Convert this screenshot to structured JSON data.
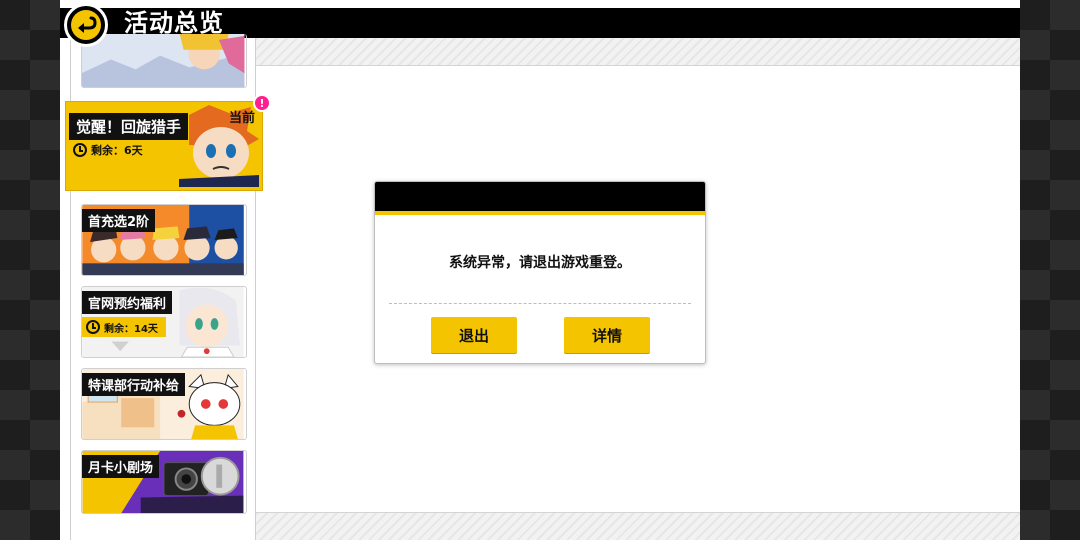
{
  "header": {
    "title": "活动总览",
    "back_icon": "back-arrow-icon"
  },
  "sidebar": {
    "cards": [
      {
        "label": "",
        "remaining": ""
      },
      {
        "label": "觉醒！回旋猎手",
        "remaining": "剩余：6天",
        "tag": "当前",
        "badge": "!",
        "active": true
      },
      {
        "label": "首充选2阶",
        "remaining": ""
      },
      {
        "label": "官网预约福利",
        "remaining": "剩余：14天"
      },
      {
        "label": "特课部行动补给",
        "remaining": ""
      },
      {
        "label": "月卡小剧场",
        "remaining": ""
      }
    ]
  },
  "modal": {
    "message": "系统异常，请退出游戏重登。",
    "exit_label": "退出",
    "details_label": "详情"
  },
  "colors": {
    "accent": "#f5c400",
    "header_bg": "#000000",
    "badge": "#ff1f8e"
  }
}
